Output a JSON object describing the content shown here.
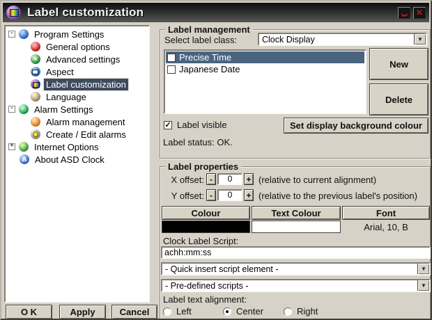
{
  "colors": {
    "dialog-bg": "#d6d2c7",
    "titlebar-top": "#0d0d0d",
    "titlebar-bottom": "#565656",
    "selection-tree": "#3f4b5e",
    "selection-list": "#4a6480",
    "button-face": "#d8d3c7",
    "close-glyph": "#c31414"
  },
  "window": {
    "title": "Label customization",
    "close_glyph": "✕"
  },
  "tree": {
    "items": [
      {
        "label": "Program Settings",
        "expander": "-",
        "icon": "program-settings-icon",
        "selected": false
      },
      {
        "label": "General options",
        "icon": "general-options-icon",
        "selected": false
      },
      {
        "label": "Advanced settings",
        "icon": "advanced-settings-icon",
        "selected": false
      },
      {
        "label": "Aspect",
        "icon": "aspect-icon",
        "selected": false
      },
      {
        "label": "Label customization",
        "icon": "label-customization-icon",
        "selected": true
      },
      {
        "label": "Language",
        "icon": "language-icon",
        "selected": false
      },
      {
        "label": "Alarm Settings",
        "expander": "-",
        "icon": "alarm-settings-icon",
        "selected": false
      },
      {
        "label": "Alarm management",
        "icon": "alarm-management-icon",
        "selected": false
      },
      {
        "label": "Create / Edit alarms",
        "icon": "create-edit-alarms-icon",
        "selected": false
      },
      {
        "label": "Internet Options",
        "expander": "+",
        "icon": "internet-options-icon",
        "selected": false
      },
      {
        "label": "About ASD Clock",
        "icon": "about-asd-clock-icon",
        "selected": false
      }
    ]
  },
  "footer_buttons": {
    "ok": "O K",
    "apply": "Apply",
    "cancel": "Cancel"
  },
  "label_management": {
    "legend": "Label management",
    "select_class_label": "Select label class:",
    "select_class_value": "Clock Display",
    "dropdown_arrow": "▼",
    "list": [
      {
        "label": "Precise Time",
        "checked": false,
        "selected": true
      },
      {
        "label": "Japanese Date",
        "checked": false,
        "selected": false
      }
    ],
    "new_button": "New",
    "delete_button": "Delete",
    "label_visible": {
      "label": "Label visible",
      "checked": true,
      "glyph": "✓"
    },
    "set_bg_button": "Set display background colour",
    "status": "Label status: OK."
  },
  "label_properties": {
    "legend": "Label properties",
    "x_offset": {
      "label": "X offset:",
      "minus": "-",
      "value": "0",
      "plus": "+",
      "caption": "(relative to current alignment)"
    },
    "y_offset": {
      "label": "Y offset:",
      "minus": "-",
      "value": "0",
      "plus": "+",
      "caption": "(relative to the previous label's position)"
    },
    "colour_button": "Colour",
    "text_colour_button": "Text Colour",
    "font_button": "Font",
    "colour_swatch": "#000000",
    "text_colour_swatch": "#ffffff",
    "font_value": "Arial, 10, B",
    "script_label": "Clock Label Script:",
    "script_value": "achh:mm:ss",
    "quick_insert_dropdown": "- Quick insert script element -",
    "predefined_dropdown": "- Pre-defined scripts -",
    "alignment_label": "Label text alignment:",
    "alignment_options": [
      {
        "label": "Left",
        "selected": false
      },
      {
        "label": "Center",
        "selected": true
      },
      {
        "label": "Right",
        "selected": false
      }
    ]
  }
}
